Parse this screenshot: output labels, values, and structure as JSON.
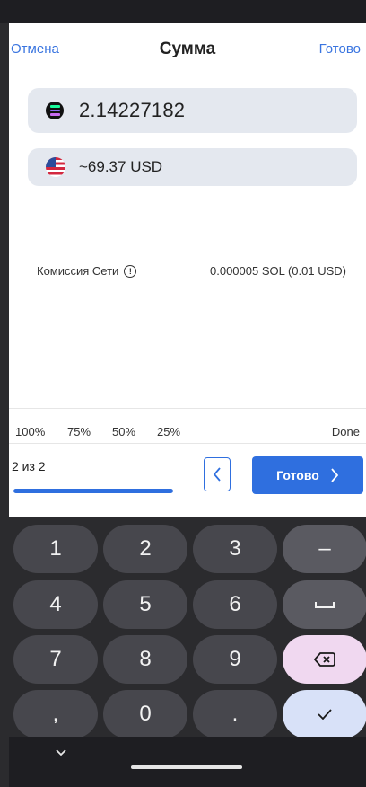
{
  "nav": {
    "cancel_label": "Отмена",
    "title": "Сумма",
    "done_label": "Готово"
  },
  "crypto_field": {
    "icon": "solana-coin-icon",
    "value": "2.14227182"
  },
  "fiat_field": {
    "icon": "us-flag-icon",
    "value": "~69.37 USD"
  },
  "fee": {
    "label": "Комиссия Сети",
    "value": "0.000005 SOL (0.01 USD)"
  },
  "percent_bar": {
    "options": [
      "100%",
      "75%",
      "50%",
      "25%"
    ],
    "done_label": "Done"
  },
  "pager": {
    "step_text": "2 из 2",
    "progress": 1.0,
    "back_icon": "chevron-left-icon",
    "next_label": "Готово",
    "next_icon": "chevron-right-icon"
  },
  "keyboard": {
    "rows": [
      [
        "1",
        "2",
        "3",
        "–"
      ],
      [
        "4",
        "5",
        "6",
        "␣"
      ],
      [
        "7",
        "8",
        "9",
        "⌫"
      ],
      [
        ",",
        "0",
        ".",
        "✓"
      ]
    ]
  },
  "colors": {
    "accent": "#2f6fdf",
    "link": "#3a75e0",
    "field_bg": "#e4e8ef",
    "key_bg": "#47474d",
    "delete_key_bg": "#f0d8f0",
    "confirm_key_bg": "#d8e1f8"
  }
}
